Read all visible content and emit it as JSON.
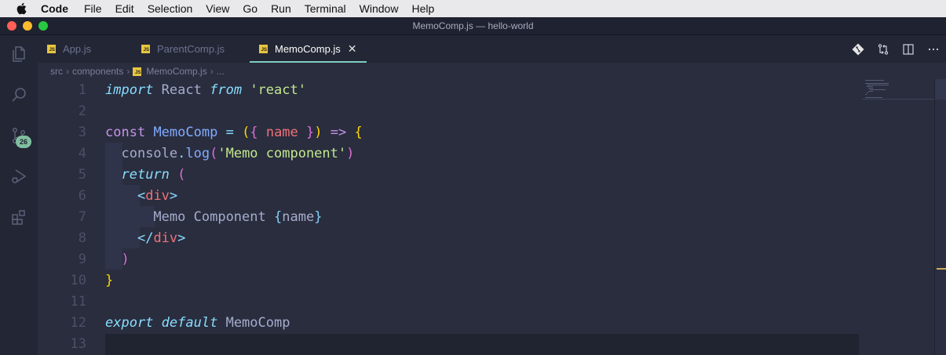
{
  "menubar": {
    "app": "Code",
    "items": [
      "File",
      "Edit",
      "Selection",
      "View",
      "Go",
      "Run",
      "Terminal",
      "Window",
      "Help"
    ]
  },
  "window": {
    "title": "MemoComp.js — hello-world"
  },
  "activity": {
    "scm_badge": "26"
  },
  "tabs": [
    {
      "label": "App.js",
      "icon": "js-file-icon",
      "active": false
    },
    {
      "label": "ParentComp.js",
      "icon": "js-file-icon",
      "active": false
    },
    {
      "label": "MemoComp.js",
      "icon": "js-file-icon",
      "active": true
    }
  ],
  "breadcrumb": [
    "src",
    "components",
    "MemoComp.js",
    "..."
  ],
  "editor": {
    "line_numbers": [
      "1",
      "2",
      "3",
      "4",
      "5",
      "6",
      "7",
      "8",
      "9",
      "10",
      "11",
      "12",
      "13"
    ],
    "lines": [
      "import React from 'react'",
      "",
      "const MemoComp = ({ name }) => {",
      "  console.log('Memo component')",
      "  return (",
      "    <div>",
      "      Memo Component {name}",
      "    </div>",
      "  )",
      "}",
      "",
      "export default MemoComp",
      ""
    ]
  },
  "colors": {
    "accent": "#80cbc4",
    "background": "#292d3e",
    "keyword": "#c792ea",
    "string": "#c3e88d",
    "function": "#82aaff"
  }
}
